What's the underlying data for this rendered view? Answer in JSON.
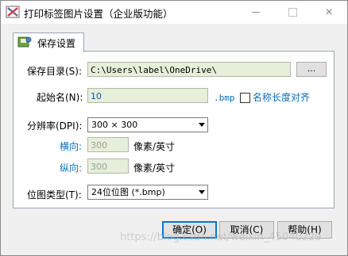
{
  "window": {
    "title": "打印标签图片设置（企业版功能）",
    "min_icon": "minimize-icon",
    "max_icon": "maximize-icon",
    "close_glyph": "✕"
  },
  "tab": {
    "label": "保存设置"
  },
  "form": {
    "save_dir_label": "保存目录(S):",
    "save_dir_value": "C:\\Users\\label\\OneDrive\\",
    "browse_label": "...",
    "start_name_label": "起始名(N):",
    "start_name_value": "10",
    "extension": ".bmp",
    "name_align_label": "名称长度对齐",
    "name_align_checked": false,
    "dpi_label": "分辨率(DPI):",
    "dpi_value": "300 × 300",
    "horizontal_label": "横向:",
    "horizontal_value": "300",
    "horizontal_unit": "像素/英寸",
    "vertical_label": "纵向:",
    "vertical_value": "300",
    "vertical_unit": "像素/英寸",
    "bitmap_label": "位图类型(T):",
    "bitmap_value": "24位位图 (*.bmp)"
  },
  "buttons": {
    "ok": "确定(O)",
    "cancel": "取消(C)",
    "help": "帮助(H)"
  },
  "watermark": "https://blog.csdn.net/weixin_45040229",
  "colors": {
    "accent": "#0a6fbd",
    "input_bg": "#e5efd9",
    "default_border": "#0078d7"
  }
}
